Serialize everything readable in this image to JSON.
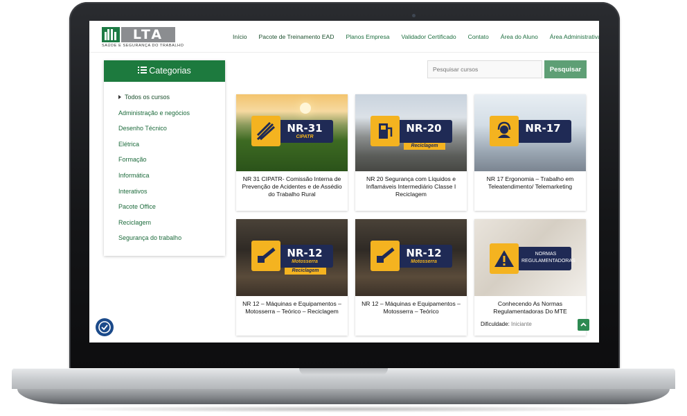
{
  "header": {
    "logo_text": "LTA",
    "logo_subtitle": "SAÚDE E SEGURANÇA DO TRABALHO",
    "nav": [
      "Início",
      "Pacote de Treinamento EAD",
      "Planos Empresa",
      "Validador Certificado",
      "Contato",
      "Área do Aluno",
      "Área Administrativa"
    ]
  },
  "sidebar": {
    "title": "Categorias",
    "items": [
      "Todos os cursos",
      "Administração e negócios",
      "Desenho Técnico",
      "Elétrica",
      "Formação",
      "Informática",
      "Interativos",
      "Pacote Office",
      "Reciclagem",
      "Segurança do trabalho"
    ]
  },
  "search": {
    "placeholder": "Pesquisar cursos",
    "button": "Pesquisar"
  },
  "courses": [
    {
      "title": "NR 31 CIPATR- Comissão Interna de Prevenção de Acidentes e de Assédio do Trabalho Rural",
      "badge": "NR-31",
      "badge_sub": "CIPATR",
      "icon": "wheat-icon"
    },
    {
      "title": "NR 20 Segurança com Líquidos e Inflamáveis Intermediário Classe I Reciclagem",
      "badge": "NR-20",
      "badge_sub": "Reciclagem",
      "icon": "fuel-pump-icon"
    },
    {
      "title": "NR 17 Ergonomia – Trabalho em Teleatendimento/ Telemarketing",
      "badge": "NR-17",
      "icon": "headset-icon"
    },
    {
      "title": "NR 12 – Máquinas e Equipamentos – Motosserra – Teórico – Reciclagem",
      "badge": "NR-12",
      "badge_sub": "Motosserra",
      "badge_ribbon": "Reciclagem",
      "icon": "chainsaw-icon"
    },
    {
      "title": "NR 12 – Máquinas e Equipamentos – Motosserra – Teórico",
      "badge": "NR-12",
      "badge_sub": "Motosserra",
      "icon": "chainsaw-icon"
    },
    {
      "title": "Conhecendo As Normas Regulamentadoras Do MTE",
      "badge": "NORMAS REGULAMENTADORAS",
      "icon": "warning-icon",
      "difficulty_label": "Dificuldade:",
      "difficulty": "Iniciante"
    }
  ],
  "colors": {
    "brand_green": "#1d7a3e",
    "button_green": "#5e9f75",
    "badge_navy": "#1f2a55",
    "badge_yellow": "#f4b320"
  }
}
